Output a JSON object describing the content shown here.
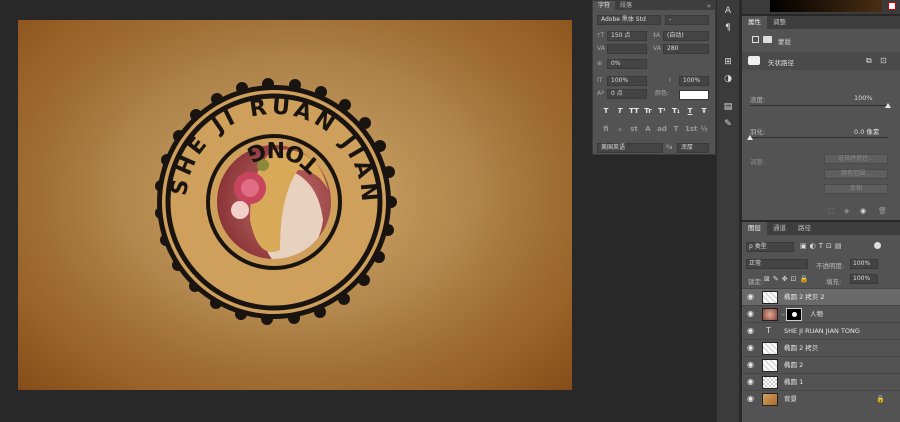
{
  "stamp": {
    "ring_text": "SHE JI RUAN JIAN",
    "bottom_text": "TONG"
  },
  "character_panel": {
    "tabs": [
      "字符",
      "段落"
    ],
    "font_family": "Adobe 黑体 Std",
    "font_style": "-",
    "font_size": "150 点",
    "leading": "(自动)",
    "kerning": "",
    "tracking": "280",
    "tsume": "0%",
    "vscale": "100%",
    "hscale": "100%",
    "baseline": "0 点",
    "color_label": "颜色:",
    "language": "美国英语",
    "antialias": "浑厚",
    "type_buttons": [
      "T",
      "T",
      "TT",
      "Tr",
      "T¹",
      "T₁",
      "T",
      "Ŧ"
    ],
    "ot_buttons": [
      "fi",
      "ℴ",
      "st",
      "A",
      "ad",
      "T",
      "1st",
      "½"
    ]
  },
  "properties": {
    "tabs": [
      "属性",
      "调整"
    ],
    "mask_label": "蒙版",
    "vector_label": "矢状路径",
    "density_label": "浓度:",
    "density_value": "100%",
    "density": 1.0,
    "feather_label": "羽化:",
    "feather_value": "0.0 像素",
    "feather": 0.0,
    "adjust_label": "调整:",
    "buttons": [
      "选择并遮住...",
      "颜色范围...",
      "反相"
    ]
  },
  "layers_panel": {
    "tabs": [
      "图层",
      "通道",
      "路径"
    ],
    "filter_kind": "ρ 类型",
    "blend_mode": "正常",
    "opacity_label": "不透明度:",
    "opacity_value": "100%",
    "lock_label": "锁定:",
    "fill_label": "填充:",
    "fill_value": "100%",
    "layers": [
      {
        "name": "椭圆 2 拷贝 2",
        "type": "shape",
        "selected": true
      },
      {
        "name": "人物",
        "type": "masked",
        "selected": false
      },
      {
        "name": "SHE JI RUAN JIAN TONG",
        "type": "text",
        "selected": false
      },
      {
        "name": "椭圆 2 拷贝",
        "type": "shape",
        "selected": false
      },
      {
        "name": "椭圆 2",
        "type": "shape",
        "selected": false
      },
      {
        "name": "椭圆 1",
        "type": "empty",
        "selected": false
      },
      {
        "name": "背景",
        "type": "background",
        "selected": false
      }
    ]
  },
  "colors": {
    "panel_bg": "#535353",
    "app_bg": "#282828",
    "paper": "#cf9f5c",
    "stamp_ink": "#1a1410"
  }
}
